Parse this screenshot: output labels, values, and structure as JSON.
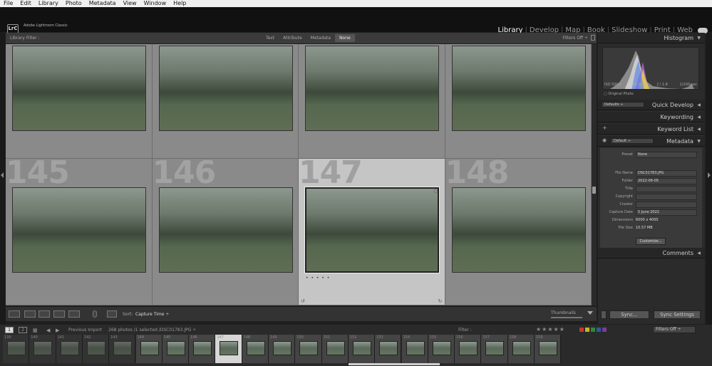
{
  "menu": [
    "File",
    "Edit",
    "Library",
    "Photo",
    "Metadata",
    "View",
    "Window",
    "Help"
  ],
  "app": {
    "badge": "LrC",
    "title": "Adobe Lightroom Classic"
  },
  "modules": [
    {
      "label": "Library",
      "active": true
    },
    {
      "label": "Develop",
      "active": false
    },
    {
      "label": "Map",
      "active": false
    },
    {
      "label": "Book",
      "active": false
    },
    {
      "label": "Slideshow",
      "active": false
    },
    {
      "label": "Print",
      "active": false
    },
    {
      "label": "Web",
      "active": false
    }
  ],
  "library_filter": {
    "label": "Library Filter :",
    "tabs": [
      {
        "label": "Text",
        "on": false
      },
      {
        "label": "Attribute",
        "on": false
      },
      {
        "label": "Metadata",
        "on": false
      },
      {
        "label": "None",
        "on": true
      }
    ],
    "preset": "Filters Off ÷"
  },
  "grid": {
    "rows": [
      [
        {
          "num": "",
          "sel": false
        },
        {
          "num": "",
          "sel": false
        },
        {
          "num": "",
          "sel": false
        },
        {
          "num": "",
          "sel": false
        }
      ],
      [
        {
          "num": "145",
          "sel": false
        },
        {
          "num": "146",
          "sel": false
        },
        {
          "num": "147",
          "sel": true
        },
        {
          "num": "148",
          "sel": false
        }
      ]
    ],
    "rating_dots": "• • • • •"
  },
  "toolbar": {
    "sort_label": "Sort:",
    "sort_value": "Capture Time ÷",
    "thumbnails_label": "Thumbnails"
  },
  "panels": {
    "histogram": "Histogram",
    "hist_info": [
      "ISO 5000",
      "85 mm",
      "ƒ / 1.8",
      "1/100 sec"
    ],
    "original_photo": "Original Photo",
    "quick_develop": "Quick Develop",
    "quick_develop_preset": "Defaults ÷",
    "keywording": "Keywording",
    "keyword_list": "Keyword List",
    "metadata": "Metadata",
    "metadata_preset": "Default ÷",
    "comments": "Comments"
  },
  "metadata_fields": [
    {
      "k": "Preset",
      "v": "None",
      "box": true
    },
    {
      "k": "File Name",
      "v": "DSC01783.JPG",
      "box": true
    },
    {
      "k": "Folder",
      "v": "2022-06-05",
      "box": true
    },
    {
      "k": "Title",
      "v": "",
      "box": true
    },
    {
      "k": "Copyright",
      "v": "",
      "box": true
    },
    {
      "k": "Creator",
      "v": "",
      "box": true
    },
    {
      "k": "Capture Date",
      "v": "5 June 2022",
      "box": true
    },
    {
      "k": "Dimensions",
      "v": "6000 x 4000",
      "box": false
    },
    {
      "k": "File Size",
      "v": "10.57 MB",
      "box": false
    }
  ],
  "customize_label": "Customize...",
  "sync": {
    "sync": "Sync...",
    "sync_settings": "Sync Settings"
  },
  "secondary": {
    "page1": "1",
    "page2": "2",
    "source": "Previous Import",
    "count": "268 photos /1 selected /DSC01783.JPG ÷",
    "filter": "Filter :",
    "stars": "★★★★★",
    "filters_off": "Filters Off ÷"
  },
  "filmstrip": [
    "139",
    "140",
    "141",
    "142",
    "143",
    "144",
    "145",
    "146",
    "147",
    "148",
    "149",
    "150",
    "151",
    "152",
    "153",
    "154",
    "155",
    "156",
    "157",
    "158",
    "159"
  ],
  "colors": {
    "accent": "#d6d6d6",
    "label_red": "#c0392b",
    "label_yellow": "#c9b41f",
    "label_green": "#2e8b3a",
    "label_blue": "#2c5aa0",
    "label_purple": "#7d3c98"
  }
}
